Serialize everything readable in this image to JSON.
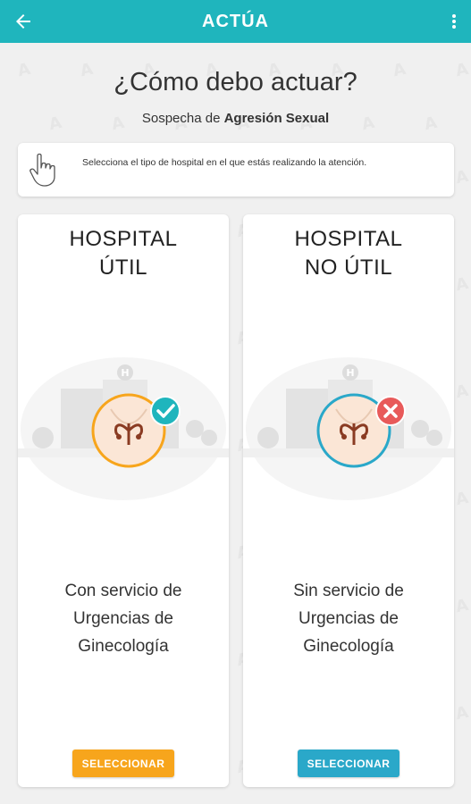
{
  "appbar": {
    "title": "ACTÚA",
    "back_icon": "arrow-left-icon",
    "menu_icon": "more-vert-icon",
    "color": "#1fb5bd"
  },
  "header": {
    "title": "¿Cómo debo actuar?",
    "subtitle_prefix": "Sospecha de ",
    "subtitle_bold": "Agresión Sexual"
  },
  "instruction": {
    "icon": "pointing-hand-icon",
    "text": "Selecciona el tipo de hospital en el que estás realizando la atención."
  },
  "cards": [
    {
      "title_line1": "HOSPITAL",
      "title_line2": "ÚTIL",
      "status_icon": "check-icon",
      "desc_line1": "Con servicio de",
      "desc_line2": "Urgencias de",
      "desc_line3": "Ginecología",
      "button_label": "SELECCIONAR",
      "accent": "#f7a51c",
      "badge_color": "#1fb5bd"
    },
    {
      "title_line1": "HOSPITAL",
      "title_line2": "NO ÚTIL",
      "status_icon": "cross-icon",
      "desc_line1": "Sin servicio de",
      "desc_line2": "Urgencias de",
      "desc_line3": "Ginecología",
      "button_label": "SELECCIONAR",
      "accent": "#2aa8c9",
      "badge_color": "#e85a5a"
    }
  ]
}
